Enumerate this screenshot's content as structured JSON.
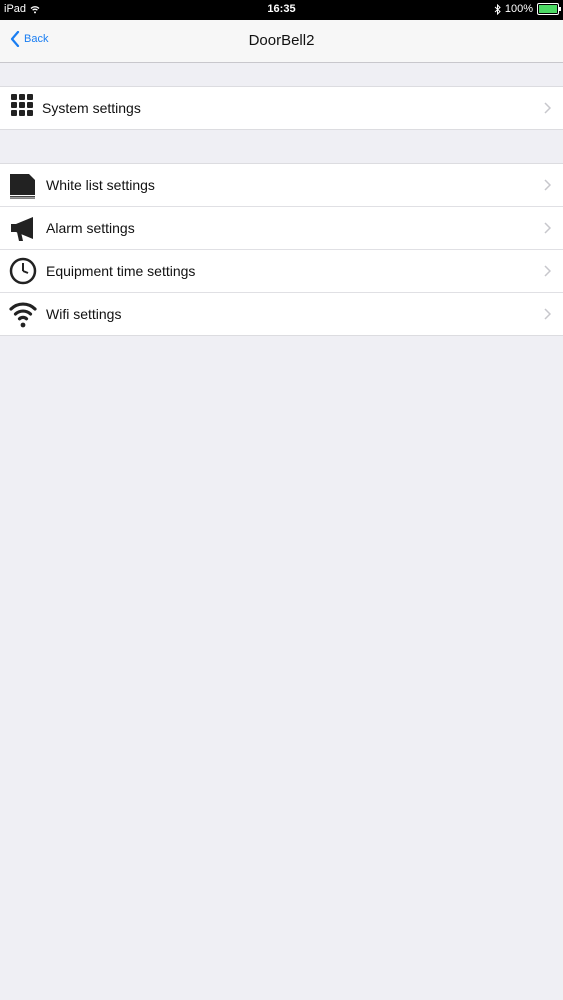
{
  "status_bar": {
    "device": "iPad",
    "time": "16:35",
    "battery": "100%"
  },
  "nav": {
    "back_label": "Back",
    "title": "DoorBell2"
  },
  "groups": [
    {
      "items": [
        {
          "label": "System settings",
          "icon": "grid-icon"
        }
      ]
    },
    {
      "items": [
        {
          "label": "White list settings",
          "icon": "document-stack-icon"
        },
        {
          "label": "Alarm settings",
          "icon": "megaphone-icon"
        },
        {
          "label": "Equipment time settings",
          "icon": "clock-icon"
        },
        {
          "label": "Wifi settings",
          "icon": "wifi-icon"
        }
      ]
    }
  ],
  "colors": {
    "accent": "#1a7ef2",
    "background": "#efeff4",
    "battery": "#4cd964"
  }
}
